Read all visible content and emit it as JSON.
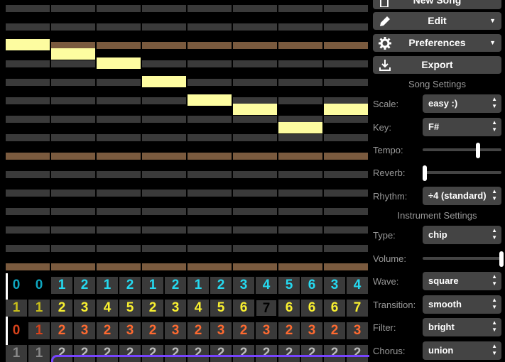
{
  "colors": {
    "row_normal": "#3a3a3a",
    "row_octave": "#7a5a3e",
    "note": "#fdfca0",
    "channel_colors": [
      "#25d9f0",
      "#f9f030",
      "#ff6a30",
      "#bbbbbb"
    ],
    "channel_dim_colors": [
      "#0ea7c0",
      "#c9bf1a",
      "#d8431b",
      "#888888"
    ],
    "highlight": "#f9f030",
    "loop_frame": "#7744ff"
  },
  "piano_roll": {
    "row_types": [
      "normal",
      "normal",
      "octave",
      "normal",
      "normal",
      "normal",
      "normal",
      "normal",
      "octave",
      "normal",
      "normal",
      "normal",
      "normal",
      "normal",
      "octave"
    ],
    "notes": [
      {
        "bar": 0,
        "row": 2
      },
      {
        "bar": 1,
        "row": 2.5
      },
      {
        "bar": 2,
        "row": 3
      },
      {
        "bar": 3,
        "row": 4
      },
      {
        "bar": 4,
        "row": 5
      },
      {
        "bar": 5,
        "row": 5.5
      },
      {
        "bar": 6,
        "row": 6.5
      },
      {
        "bar": 7,
        "row": 5.5
      }
    ]
  },
  "pattern_grid": {
    "channels": [
      [
        "0",
        "0",
        "1",
        "2",
        "1",
        "2",
        "1",
        "2",
        "1",
        "2",
        "3",
        "4",
        "5",
        "6",
        "3",
        "4"
      ],
      [
        "1",
        "1",
        "2",
        "3",
        "4",
        "5",
        "2",
        "3",
        "4",
        "5",
        "6",
        "7",
        "6",
        "6",
        "6",
        "7"
      ],
      [
        "0",
        "1",
        "2",
        "3",
        "2",
        "3",
        "2",
        "3",
        "2",
        "3",
        "2",
        "3",
        "2",
        "3",
        "2",
        "3"
      ],
      [
        "1",
        "1",
        "2",
        "2",
        "2",
        "2",
        "2",
        "2",
        "2",
        "2",
        "2",
        "2",
        "2",
        "2",
        "2",
        "2"
      ]
    ],
    "highlight_channel": 1,
    "highlight_column": 11
  },
  "menu": {
    "new_song": "New Song",
    "edit": "Edit",
    "preferences": "Preferences",
    "export": "Export"
  },
  "song_settings": {
    "title": "Song Settings",
    "scale_label": "Scale:",
    "scale_value": "easy :)",
    "key_label": "Key:",
    "key_value": "F#",
    "tempo_label": "Tempo:",
    "tempo_level": 0.7,
    "reverb_label": "Reverb:",
    "reverb_level": 0.03,
    "rhythm_label": "Rhythm:",
    "rhythm_value": "÷4 (standard)"
  },
  "instrument_settings": {
    "title": "Instrument Settings",
    "type_label": "Type:",
    "type_value": "chip",
    "volume_label": "Volume:",
    "volume_level": 1.0,
    "wave_label": "Wave:",
    "wave_value": "square",
    "transition_label": "Transition:",
    "transition_value": "smooth",
    "filter_label": "Filter:",
    "filter_value": "bright",
    "chorus_label": "Chorus:",
    "chorus_value": "union"
  }
}
